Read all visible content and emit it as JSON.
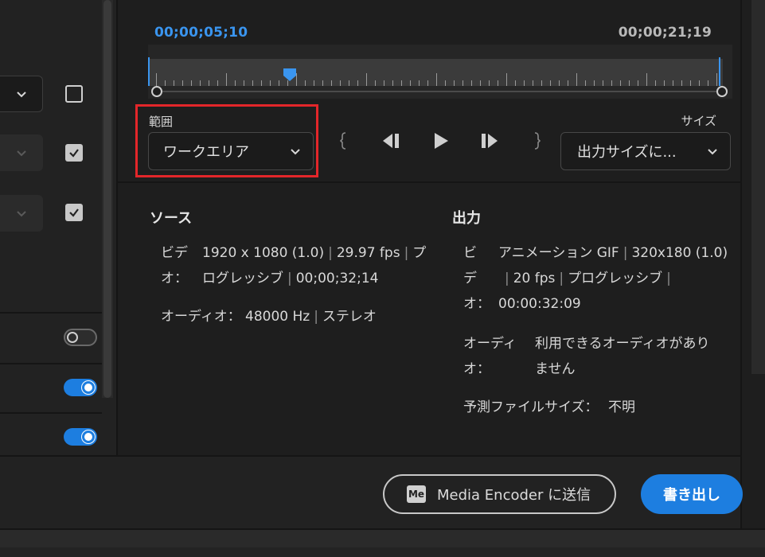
{
  "preview": {
    "current_timecode": "00;00;05;10",
    "total_timecode": "00;00;21;19",
    "range_label": "範囲",
    "range_value": "ワークエリア",
    "size_label": "サイズ",
    "size_value": "出力サイズに..."
  },
  "summary": {
    "source_title": "ソース",
    "output_title": "出力",
    "source": {
      "video_key_1": "ビデ",
      "video_key_2": "オ：",
      "video_res": "1920 x 1080 (1.0)",
      "video_fps": "29.97 fps",
      "video_tail": "プ",
      "video_scan": "ログレッシブ",
      "video_duration": "00;00;32;14",
      "audio_key": "オーディオ：",
      "audio_rate": "48000 Hz",
      "audio_channels": "ステレオ"
    },
    "output": {
      "video_key_1": "ビ",
      "video_key_2": "デ",
      "video_key_3": "オ：",
      "video_format": "アニメーション GIF",
      "video_res": "320x180 (1.0)",
      "video_fps": "20 fps",
      "video_scan": "プログレッシブ",
      "video_duration": "00:00:32:09",
      "audio_key_1": "オーディ",
      "audio_key_2": "オ：",
      "audio_value_1": "利用できるオーディオがあり",
      "audio_value_2": "ません",
      "filesize_key": "予測ファイルサイズ：",
      "filesize_value": "不明"
    }
  },
  "footer": {
    "me_icon_text": "Me",
    "media_encoder_label": "Media Encoder に送信",
    "export_label": "書き出し"
  },
  "left_panel": {
    "toggle_1": "off",
    "toggle_2": "on",
    "toggle_3": "on",
    "checkbox_1": "unchecked",
    "checkbox_2": "checked",
    "checkbox_3": "checked"
  },
  "colors": {
    "accent": "#1d7ee0",
    "timecode_current": "#3a95ef",
    "highlight": "#e3262a",
    "background": "#1e1e1e"
  }
}
